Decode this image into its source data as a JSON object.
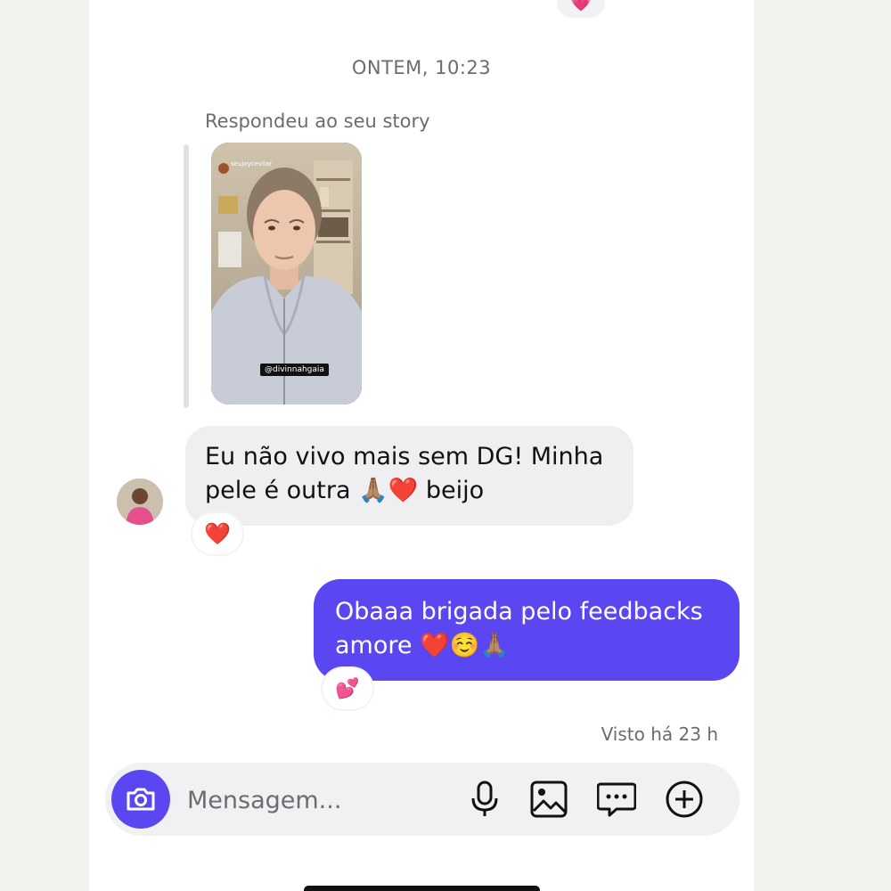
{
  "header": {
    "top_reaction_icon": "heart-emoji"
  },
  "thread": {
    "timestamp": "ONTEM, 10:23",
    "reply_label": "Respondeu ao seu story",
    "story": {
      "username": "seujoycevilar",
      "tag": "@divinnahgaia"
    },
    "incoming": {
      "text": "Eu não vivo mais sem DG! Minha pele é outra 🙏🏽❤️ beijo",
      "reaction": "❤️"
    },
    "outgoing": {
      "text": "Obaaa brigada pelo feedbacks amore ❤️☺️🙏🏽",
      "reaction": "💕"
    },
    "seen": "Visto há 23 h"
  },
  "composer": {
    "placeholder": "Mensagem...",
    "icons": [
      "camera-icon",
      "microphone-icon",
      "image-icon",
      "sticker-chat-icon",
      "plus-circle-icon"
    ]
  },
  "colors": {
    "accent": "#5b47f2",
    "incoming_bubble": "#efeff2",
    "muted_text": "#6c6c70"
  }
}
